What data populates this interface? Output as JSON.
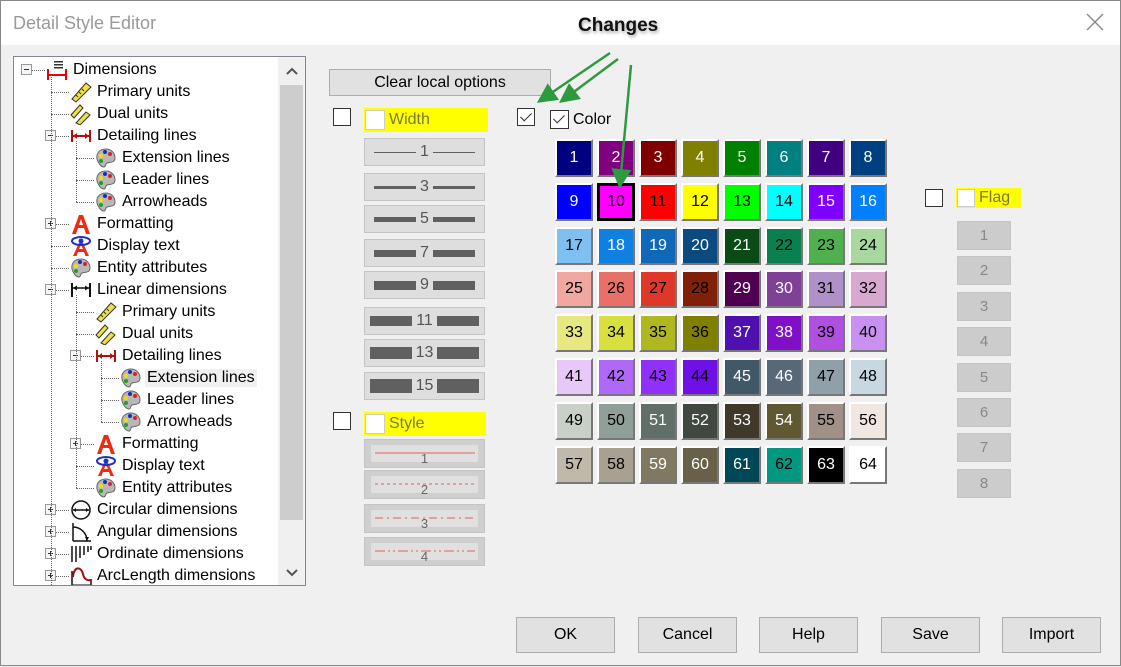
{
  "window": {
    "title": "Detail Style Editor",
    "close_icon": "close-icon"
  },
  "annotation": {
    "text": "Changes",
    "arrow_color": "#2e9a3e"
  },
  "tree": {
    "items": [
      {
        "label": "Dimensions",
        "icon": "dimensions-icon",
        "level": 0,
        "expander": "minus"
      },
      {
        "label": "Primary units",
        "icon": "ruler-icon",
        "level": 1
      },
      {
        "label": "Dual units",
        "icon": "dual-ruler-icon",
        "level": 1
      },
      {
        "label": "Detailing lines",
        "icon": "detailing-lines-icon",
        "level": 1,
        "expander": "minus"
      },
      {
        "label": "Extension lines",
        "icon": "palette-icon",
        "level": 2
      },
      {
        "label": "Leader lines",
        "icon": "palette-icon",
        "level": 2
      },
      {
        "label": "Arrowheads",
        "icon": "palette-icon",
        "level": 2
      },
      {
        "label": "Formatting",
        "icon": "font-a-icon",
        "level": 1,
        "expander": "plus"
      },
      {
        "label": "Display text",
        "icon": "display-text-icon",
        "level": 1
      },
      {
        "label": "Entity attributes",
        "icon": "palette-icon",
        "level": 1
      },
      {
        "label": "Linear dimensions",
        "icon": "linear-dimension-icon",
        "level": 1,
        "expander": "minus"
      },
      {
        "label": "Primary units",
        "icon": "ruler-icon",
        "level": 2
      },
      {
        "label": "Dual units",
        "icon": "dual-ruler-icon",
        "level": 2
      },
      {
        "label": "Detailing lines",
        "icon": "detailing-lines-icon",
        "level": 2,
        "expander": "minus"
      },
      {
        "label": "Extension lines",
        "icon": "palette-icon",
        "level": 3,
        "selected": true
      },
      {
        "label": "Leader lines",
        "icon": "palette-icon",
        "level": 3
      },
      {
        "label": "Arrowheads",
        "icon": "palette-icon",
        "level": 3
      },
      {
        "label": "Formatting",
        "icon": "font-a-icon",
        "level": 2,
        "expander": "plus"
      },
      {
        "label": "Display text",
        "icon": "display-text-icon",
        "level": 2
      },
      {
        "label": "Entity attributes",
        "icon": "palette-icon",
        "level": 2
      },
      {
        "label": "Circular dimensions",
        "icon": "circular-dimension-icon",
        "level": 1,
        "expander": "plus"
      },
      {
        "label": "Angular dimensions",
        "icon": "angular-dimension-icon",
        "level": 1,
        "expander": "plus"
      },
      {
        "label": "Ordinate dimensions",
        "icon": "ordinate-dimension-icon",
        "level": 1,
        "expander": "plus"
      },
      {
        "label": "ArcLength dimensions",
        "icon": "arclength-dimension-icon",
        "level": 1,
        "expander": "plus"
      }
    ],
    "scroll_up": "▲",
    "scroll_down": "▼"
  },
  "options": {
    "clear_local_label": "Clear local options",
    "width": {
      "label": "Width",
      "checked": false,
      "values": [
        "1",
        "3",
        "5",
        "7",
        "9",
        "11",
        "13",
        "15"
      ]
    },
    "style": {
      "label": "Style",
      "checked": false,
      "values": [
        "1",
        "2",
        "3",
        "4"
      ]
    },
    "color": {
      "label": "Color",
      "checked": true,
      "outer_checked": true,
      "selected": "10"
    },
    "flag": {
      "label": "Flag",
      "checked": false,
      "values": [
        "1",
        "2",
        "3",
        "4",
        "5",
        "6",
        "7",
        "8"
      ]
    }
  },
  "colors": [
    {
      "n": "1",
      "bg": "#000080",
      "fg": "#ffffff"
    },
    {
      "n": "2",
      "bg": "#800080",
      "fg": "#ffffff"
    },
    {
      "n": "3",
      "bg": "#800000",
      "fg": "#ffffff"
    },
    {
      "n": "4",
      "bg": "#808000",
      "fg": "#ffffff"
    },
    {
      "n": "5",
      "bg": "#008000",
      "fg": "#ffffff"
    },
    {
      "n": "6",
      "bg": "#008080",
      "fg": "#ffffff"
    },
    {
      "n": "7",
      "bg": "#400080",
      "fg": "#ffffff"
    },
    {
      "n": "8",
      "bg": "#004080",
      "fg": "#ffffff"
    },
    {
      "n": "9",
      "bg": "#0000ff",
      "fg": "#ffffff"
    },
    {
      "n": "10",
      "bg": "#ff00ff",
      "fg": "#000000"
    },
    {
      "n": "11",
      "bg": "#ff0000",
      "fg": "#000000"
    },
    {
      "n": "12",
      "bg": "#ffff00",
      "fg": "#000000"
    },
    {
      "n": "13",
      "bg": "#00ff00",
      "fg": "#000000"
    },
    {
      "n": "14",
      "bg": "#00ffff",
      "fg": "#000000"
    },
    {
      "n": "15",
      "bg": "#8000ff",
      "fg": "#ffffff"
    },
    {
      "n": "16",
      "bg": "#0080ff",
      "fg": "#ffffff"
    },
    {
      "n": "17",
      "bg": "#80c0f0",
      "fg": "#000000"
    },
    {
      "n": "18",
      "bg": "#1080e0",
      "fg": "#ffffff"
    },
    {
      "n": "19",
      "bg": "#1068b8",
      "fg": "#ffffff"
    },
    {
      "n": "20",
      "bg": "#0a4a80",
      "fg": "#ffffff"
    },
    {
      "n": "21",
      "bg": "#0a4a14",
      "fg": "#ffffff"
    },
    {
      "n": "22",
      "bg": "#0a8050",
      "fg": "#000000"
    },
    {
      "n": "23",
      "bg": "#50b050",
      "fg": "#000000"
    },
    {
      "n": "24",
      "bg": "#a8d8a0",
      "fg": "#000000"
    },
    {
      "n": "25",
      "bg": "#f0a8a0",
      "fg": "#000000"
    },
    {
      "n": "26",
      "bg": "#e87068",
      "fg": "#000000"
    },
    {
      "n": "27",
      "bg": "#e03828",
      "fg": "#000000"
    },
    {
      "n": "28",
      "bg": "#802008",
      "fg": "#000000"
    },
    {
      "n": "29",
      "bg": "#500050",
      "fg": "#ffffff"
    },
    {
      "n": "30",
      "bg": "#804098",
      "fg": "#ffffff"
    },
    {
      "n": "31",
      "bg": "#b090c8",
      "fg": "#000000"
    },
    {
      "n": "32",
      "bg": "#d8a8d0",
      "fg": "#000000"
    },
    {
      "n": "33",
      "bg": "#e8e880",
      "fg": "#000000"
    },
    {
      "n": "34",
      "bg": "#d8e040",
      "fg": "#000000"
    },
    {
      "n": "35",
      "bg": "#b0b820",
      "fg": "#000000"
    },
    {
      "n": "36",
      "bg": "#808000",
      "fg": "#000000"
    },
    {
      "n": "37",
      "bg": "#5010b0",
      "fg": "#ffffff"
    },
    {
      "n": "38",
      "bg": "#8010c8",
      "fg": "#ffffff"
    },
    {
      "n": "39",
      "bg": "#b050e0",
      "fg": "#000000"
    },
    {
      "n": "40",
      "bg": "#c890f0",
      "fg": "#000000"
    },
    {
      "n": "41",
      "bg": "#e8c8f8",
      "fg": "#000000"
    },
    {
      "n": "42",
      "bg": "#b068f8",
      "fg": "#000000"
    },
    {
      "n": "43",
      "bg": "#9030f8",
      "fg": "#000000"
    },
    {
      "n": "44",
      "bg": "#7010e8",
      "fg": "#000000"
    },
    {
      "n": "45",
      "bg": "#405868",
      "fg": "#ffffff"
    },
    {
      "n": "46",
      "bg": "#586878",
      "fg": "#ffffff"
    },
    {
      "n": "47",
      "bg": "#90a0a8",
      "fg": "#000000"
    },
    {
      "n": "48",
      "bg": "#c8d8e0",
      "fg": "#000000"
    },
    {
      "n": "49",
      "bg": "#c8d0c8",
      "fg": "#000000"
    },
    {
      "n": "50",
      "bg": "#90a098",
      "fg": "#000000"
    },
    {
      "n": "51",
      "bg": "#607068",
      "fg": "#ffffff"
    },
    {
      "n": "52",
      "bg": "#404840",
      "fg": "#ffffff"
    },
    {
      "n": "53",
      "bg": "#403828",
      "fg": "#ffffff"
    },
    {
      "n": "54",
      "bg": "#605830",
      "fg": "#ffffff"
    },
    {
      "n": "55",
      "bg": "#a09088",
      "fg": "#000000"
    },
    {
      "n": "56",
      "bg": "#f0e8e0",
      "fg": "#000000"
    },
    {
      "n": "57",
      "bg": "#c0b8a8",
      "fg": "#000000"
    },
    {
      "n": "58",
      "bg": "#a8a090",
      "fg": "#000000"
    },
    {
      "n": "59",
      "bg": "#807860",
      "fg": "#ffffff"
    },
    {
      "n": "60",
      "bg": "#686048",
      "fg": "#ffffff"
    },
    {
      "n": "61",
      "bg": "#004858",
      "fg": "#ffffff"
    },
    {
      "n": "62",
      "bg": "#009880",
      "fg": "#000000"
    },
    {
      "n": "63",
      "bg": "#000000",
      "fg": "#ffffff"
    },
    {
      "n": "64",
      "bg": "#ffffff",
      "fg": "#000000"
    }
  ],
  "footer": {
    "buttons": [
      "OK",
      "Cancel",
      "Help",
      "Save",
      "Import"
    ]
  }
}
